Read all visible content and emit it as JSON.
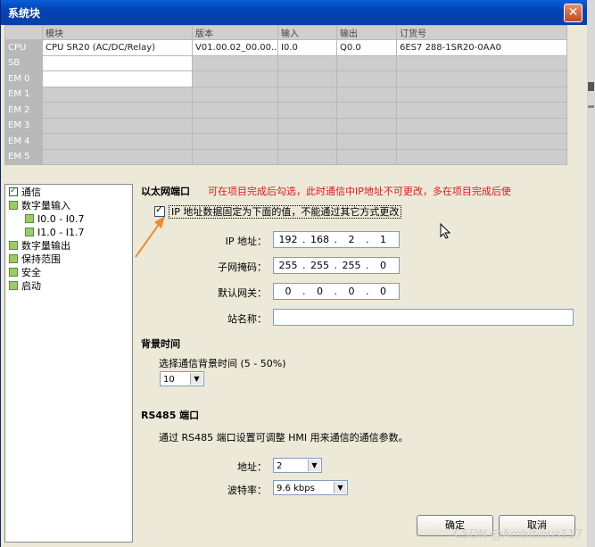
{
  "window": {
    "title": "系统块",
    "close": "✕"
  },
  "grid": {
    "headers": [
      "",
      "模块",
      "版本",
      "输入",
      "输出",
      "订货号"
    ],
    "rows": [
      {
        "slot": "CPU",
        "module": "CPU SR20 (AC/DC/Relay)",
        "version": "V01.00.02_00.00...",
        "input": "I0.0",
        "output": "Q0.0",
        "order": "6ES7 288-1SR20-0AA0"
      },
      {
        "slot": "SB",
        "module": "",
        "version": "",
        "input": "",
        "output": "",
        "order": ""
      },
      {
        "slot": "EM 0",
        "module": "",
        "version": "",
        "input": "",
        "output": "",
        "order": ""
      },
      {
        "slot": "EM 1",
        "module": "",
        "version": "",
        "input": "",
        "output": "",
        "order": ""
      },
      {
        "slot": "EM 2",
        "module": "",
        "version": "",
        "input": "",
        "output": "",
        "order": ""
      },
      {
        "slot": "EM 3",
        "module": "",
        "version": "",
        "input": "",
        "output": "",
        "order": ""
      },
      {
        "slot": "EM 4",
        "module": "",
        "version": "",
        "input": "",
        "output": "",
        "order": ""
      },
      {
        "slot": "EM 5",
        "module": "",
        "version": "",
        "input": "",
        "output": "",
        "order": ""
      }
    ]
  },
  "tree": {
    "items": [
      "通信",
      "数字量输入",
      "I0.0 - I0.7",
      "I1.0 - I1.7",
      "数字量输出",
      "保持范围",
      "安全",
      "启动"
    ]
  },
  "ethernet": {
    "title": "以太网端口",
    "annotation": "可在项目完成后勾选，此时通信中IP地址不可更改，多在项目完成后使",
    "fixed_ip_label": "IP 地址数据固定为下面的值，不能通过其它方式更改",
    "ip_label": "IP 地址：",
    "ip": [
      "192",
      "168",
      "2",
      "1"
    ],
    "mask_label": "子网掩码：",
    "mask": [
      "255",
      "255",
      "255",
      "0"
    ],
    "gateway_label": "默认网关：",
    "gateway": [
      "0",
      "0",
      "0",
      "0"
    ],
    "station_label": "站名称：",
    "station_value": ""
  },
  "background": {
    "title": "背景时间",
    "hint": "选择通信背景时间 (5 - 50%)",
    "value": "10"
  },
  "rs485": {
    "title": "RS485 端口",
    "hint": "通过 RS485 端口设置可调整 HMI 用来通信的通信参数。",
    "address_label": "地址：",
    "address_value": "2",
    "baud_label": "波特率：",
    "baud_value": "9.6 kbps"
  },
  "buttons": {
    "ok": "确定",
    "cancel": "取消"
  },
  "watermark": "CSDN @Ambitious117",
  "colors": {
    "annotation": "#e01818",
    "arrow": "#f08a30",
    "title_bar": "#0a5fd8"
  }
}
